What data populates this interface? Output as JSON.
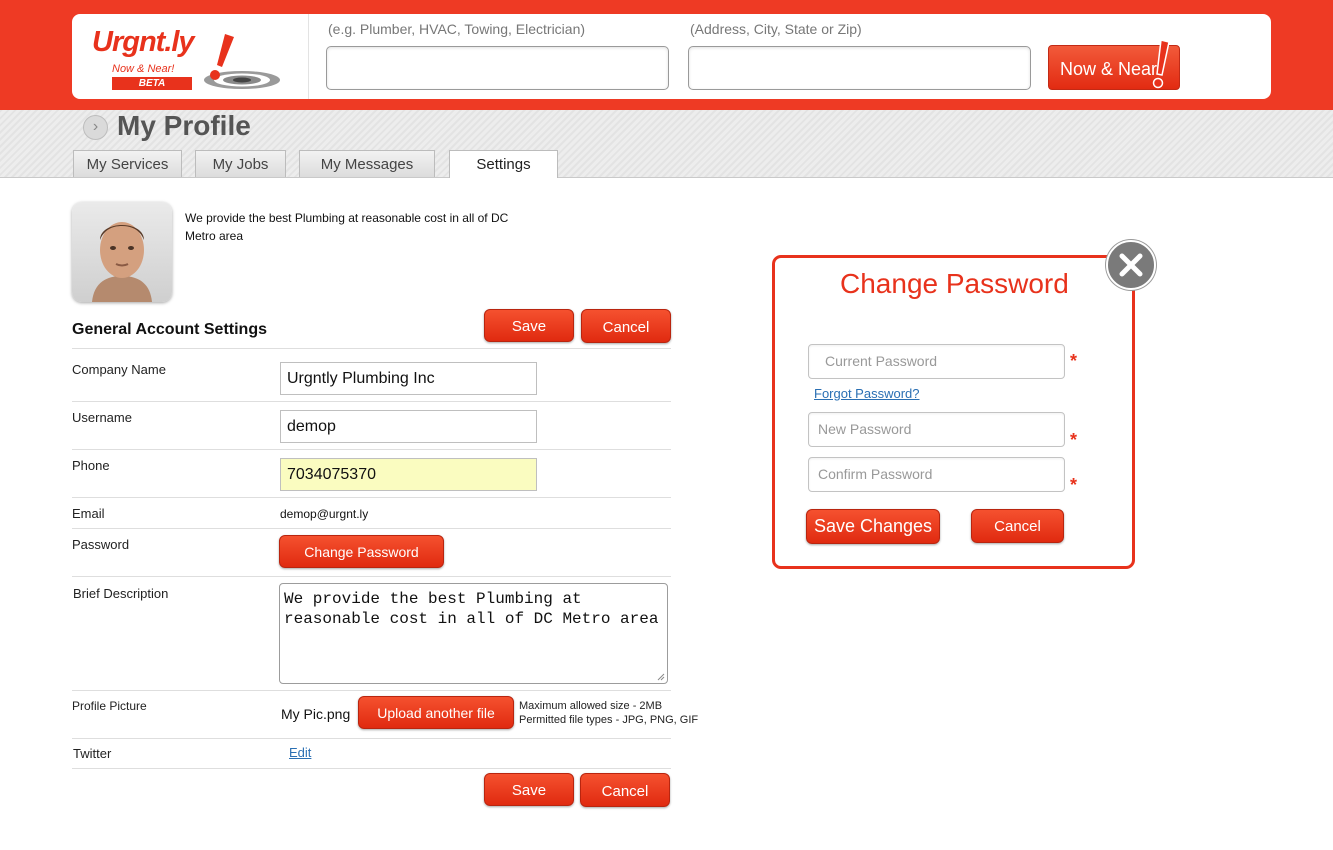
{
  "header": {
    "logo": {
      "wordmark": "Urgnt.ly",
      "tagline": "Now & Near!",
      "badge": "BETA"
    },
    "service_placeholder": "(e.g. Plumber, HVAC, Towing, Electrician)",
    "location_placeholder": "(Address, City, State or Zip)",
    "service_value": "",
    "location_value": "",
    "search_button": "Now & Near"
  },
  "page": {
    "title": "My Profile",
    "tabs": [
      {
        "label": "My Services",
        "active": false
      },
      {
        "label": "My Jobs",
        "active": false
      },
      {
        "label": "My Messages",
        "active": false
      },
      {
        "label": "Settings",
        "active": true
      }
    ]
  },
  "profile": {
    "intro": "We provide the best Plumbing at reasonable cost in all of DC Metro area"
  },
  "settings": {
    "section_title": "General Account Settings",
    "save_label": "Save",
    "cancel_label": "Cancel",
    "fields": {
      "company_name": {
        "label": "Company Name",
        "value": "Urgntly Plumbing Inc"
      },
      "username": {
        "label": "Username",
        "value": "demop"
      },
      "phone": {
        "label": "Phone",
        "value": "7034075370"
      },
      "email": {
        "label": "Email",
        "value": "demop@urgnt.ly"
      },
      "password": {
        "label": "Password",
        "button": "Change Password"
      },
      "brief_description": {
        "label": "Brief Description",
        "value": "We provide the best Plumbing at reasonable cost in all of DC Metro area"
      },
      "profile_picture": {
        "label": "Profile Picture",
        "filename": "My Pic.png",
        "button": "Upload another file",
        "max_size": "Maximum allowed size - 2MB",
        "file_types": "Permitted file types - JPG, PNG, GIF"
      },
      "twitter": {
        "label": "Twitter",
        "action": "Edit"
      }
    }
  },
  "modal": {
    "title": "Change Password",
    "current_placeholder": "Current Password",
    "forgot_link": "Forgot Password?",
    "new_placeholder": "New Password",
    "confirm_placeholder": "Confirm Password",
    "required_mark": "*",
    "save_button": "Save Changes",
    "cancel_button": "Cancel"
  },
  "colors": {
    "brand_red": "#ee3a24",
    "button_red": "#e02a10",
    "phone_highlight": "#fafcc0",
    "link_blue": "#2a6fb3"
  }
}
